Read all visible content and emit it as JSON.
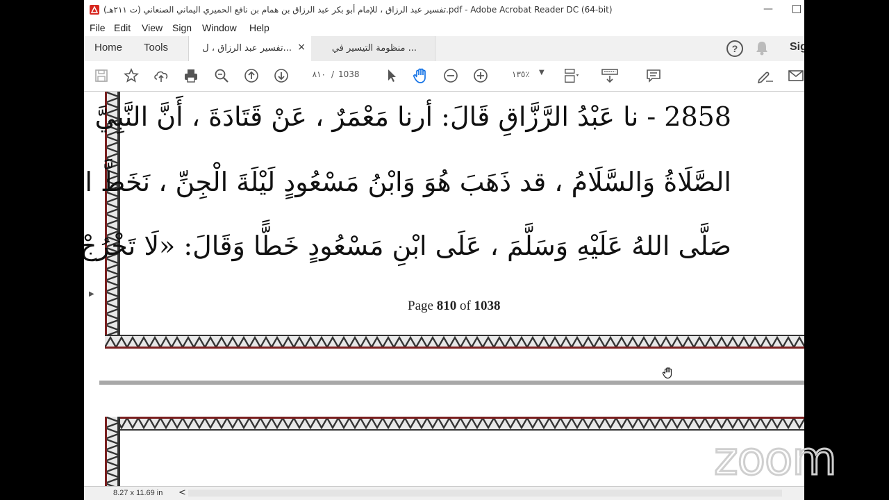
{
  "window": {
    "title": "تفسير عبد الرزاق ، للإمام أبو بكر عبد الرزاق بن همام بن نافع الحميري اليماني الصنعاني (ت ٢١١هـ).pdf - Adobe Acrobat Reader DC (64-bit)"
  },
  "menu": [
    "File",
    "Edit",
    "View",
    "Sign",
    "Window",
    "Help"
  ],
  "nav_tabs": {
    "home": "Home",
    "tools": "Tools"
  },
  "doc_tabs": [
    {
      "label": "تفسير عبد الرزاق ، ل...",
      "active": true,
      "close": "×"
    },
    {
      "label": "منظومة التيسير في ...",
      "active": false
    }
  ],
  "header_right": {
    "help": "?",
    "sign_in": "Sig"
  },
  "toolbar": {
    "page_current": "٨١٠",
    "page_separator": "/",
    "page_total": "1038",
    "zoom": "١٣٥٪",
    "icons": [
      "save-icon",
      "bookmark-star-icon",
      "upload-icon",
      "print-icon",
      "zoom-search-icon",
      "page-up-icon",
      "page-down-icon",
      "select-cursor-icon",
      "hand-tool-icon",
      "zoom-out-icon",
      "zoom-in-icon",
      "zoom-dropdown-icon",
      "page-fit-icon",
      "scroll-mode-icon",
      "comment-icon",
      "sign-pen-icon",
      "mail-icon"
    ]
  },
  "document": {
    "lines": [
      "2858 - نا عَبْدُ الرَّزَّاقِ قَالَ: أرنا مَعْمَرٌ ، عَنْ قَتَادَةَ ، أَنَّ النَّبِيَّ عَلَيْهِ",
      "الصَّلَاةُ وَالسَّلَامُ ، قد ذَهَبَ هُوَ وَابْنُ مَسْعُودٍ لَيْلَةَ الْجِنِّ ، نَخَطَّ النَّبِيُّ",
      "صَلَّى اللهُ عَلَيْهِ وَسَلَّمَ ، عَلَى ابْنِ مَسْعُودٍ خَطًّا وَقَالَ: «لَا تَخْرُجْ مِنْهُ» ، ثُمَّ"
    ],
    "footer": {
      "prefix": "Page",
      "page": "810",
      "of": "of",
      "total": "1038"
    }
  },
  "status": {
    "page_size": "8.27 x 11.69 in",
    "arrow": "<"
  },
  "overlay": {
    "logo": "zoom"
  }
}
